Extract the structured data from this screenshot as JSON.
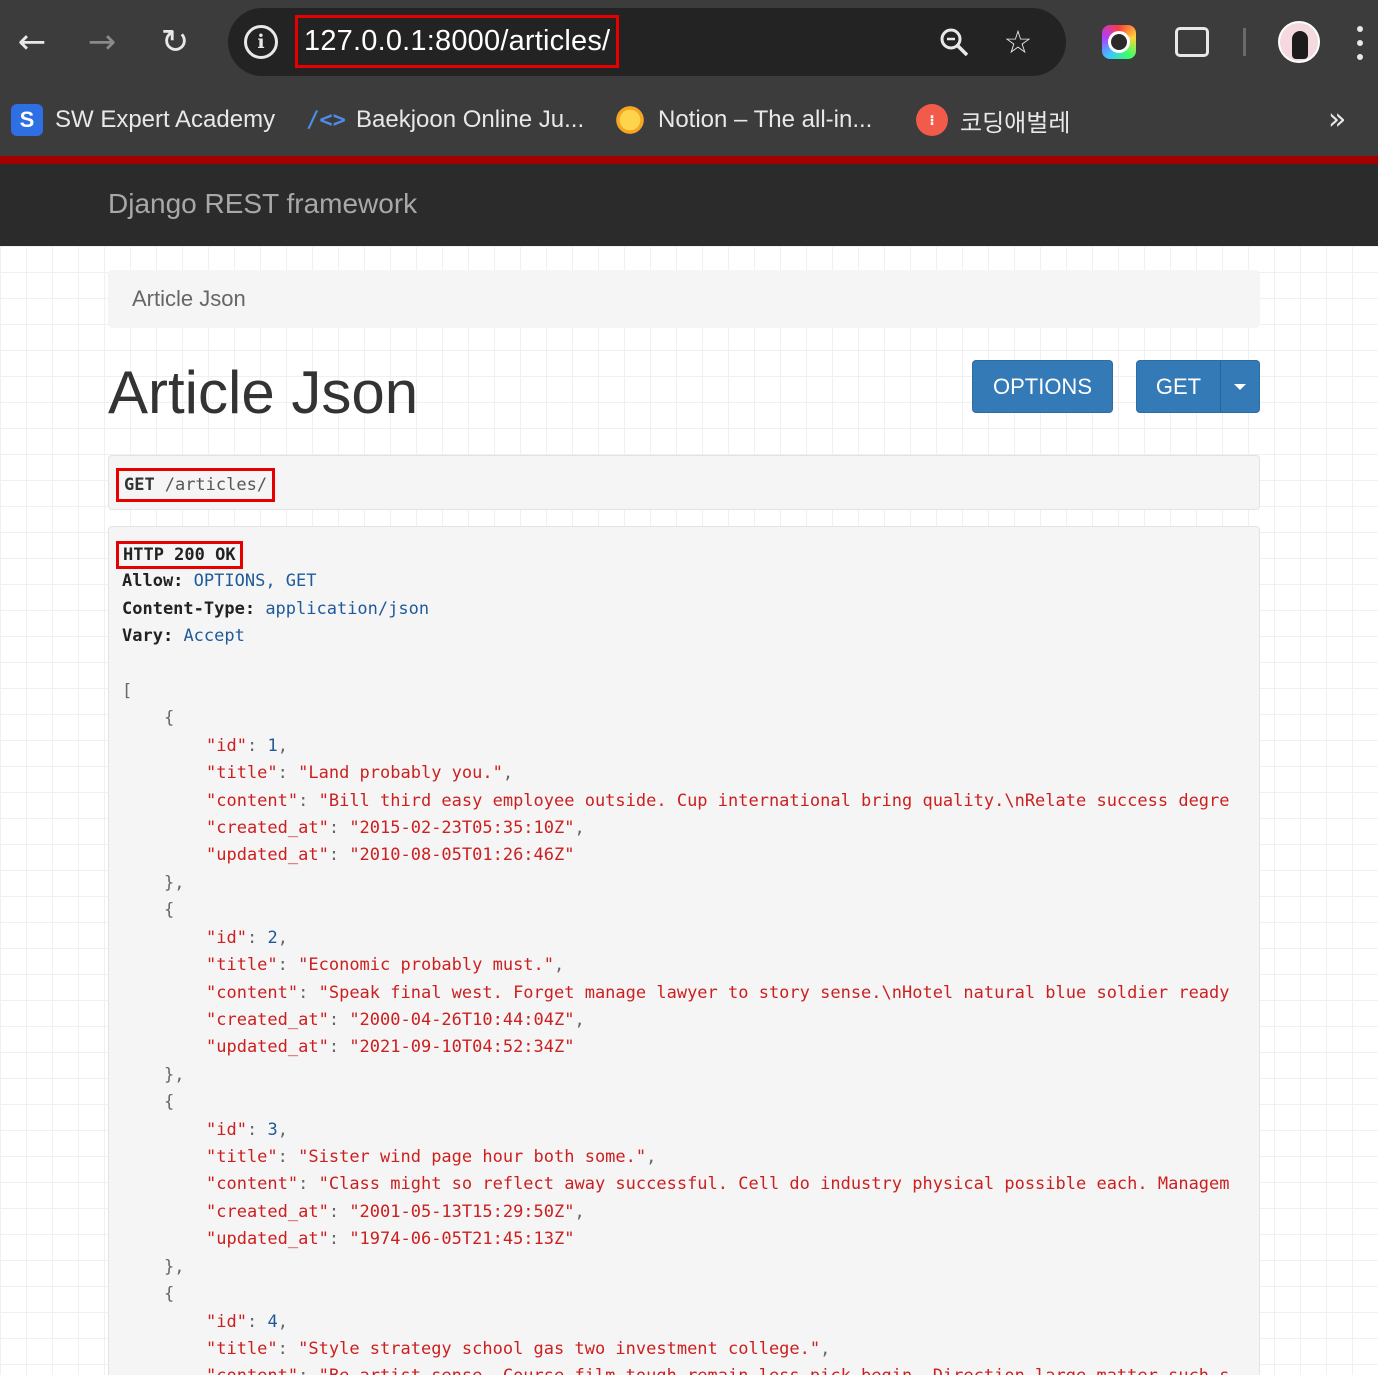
{
  "browser": {
    "url": "127.0.0.1:8000/articles/",
    "bookmarks": [
      {
        "label": "SW Expert Academy",
        "icon": "S"
      },
      {
        "label": "Baekjoon Online Ju...",
        "icon": "/<>"
      },
      {
        "label": "Notion – The all-in...",
        "icon": ""
      },
      {
        "label": "코딩애벌레",
        "icon": "⁝"
      }
    ],
    "more_glyph": "»"
  },
  "navbar": {
    "brand": "Django REST framework"
  },
  "breadcrumb": {
    "label": "Article Json"
  },
  "page": {
    "title": "Article Json"
  },
  "buttons": {
    "options": "OPTIONS",
    "get": "GET"
  },
  "request": {
    "method": "GET",
    "path": "/articles/"
  },
  "response": {
    "status": "HTTP 200 OK",
    "headers": [
      {
        "key": "Allow:",
        "value": "OPTIONS, GET"
      },
      {
        "key": "Content-Type:",
        "value": "application/json"
      },
      {
        "key": "Vary:",
        "value": "Accept"
      }
    ],
    "open_bracket": "[",
    "articles": [
      {
        "id": "1",
        "title": "\"Land probably you.\"",
        "content": "\"Bill third easy employee outside. Cup international bring quality.\\nRelate success degre",
        "created_at": "\"2015-02-23T05:35:10Z\"",
        "updated_at": "\"2010-08-05T01:26:46Z\""
      },
      {
        "id": "2",
        "title": "\"Economic probably must.\"",
        "content": "\"Speak final west. Forget manage lawyer to story sense.\\nHotel natural blue soldier ready",
        "created_at": "\"2000-04-26T10:44:04Z\"",
        "updated_at": "\"2021-09-10T04:52:34Z\""
      },
      {
        "id": "3",
        "title": "\"Sister wind page hour both some.\"",
        "content": "\"Class might so reflect away successful. Cell do industry physical possible each. Managem",
        "created_at": "\"2001-05-13T15:29:50Z\"",
        "updated_at": "\"1974-06-05T21:45:13Z\""
      },
      {
        "id": "4",
        "title": "\"Style strategy school gas two investment college.\"",
        "content": "\"Be artist sense. Course film tough remain less pick begin. Direction large matter such s"
      }
    ]
  }
}
